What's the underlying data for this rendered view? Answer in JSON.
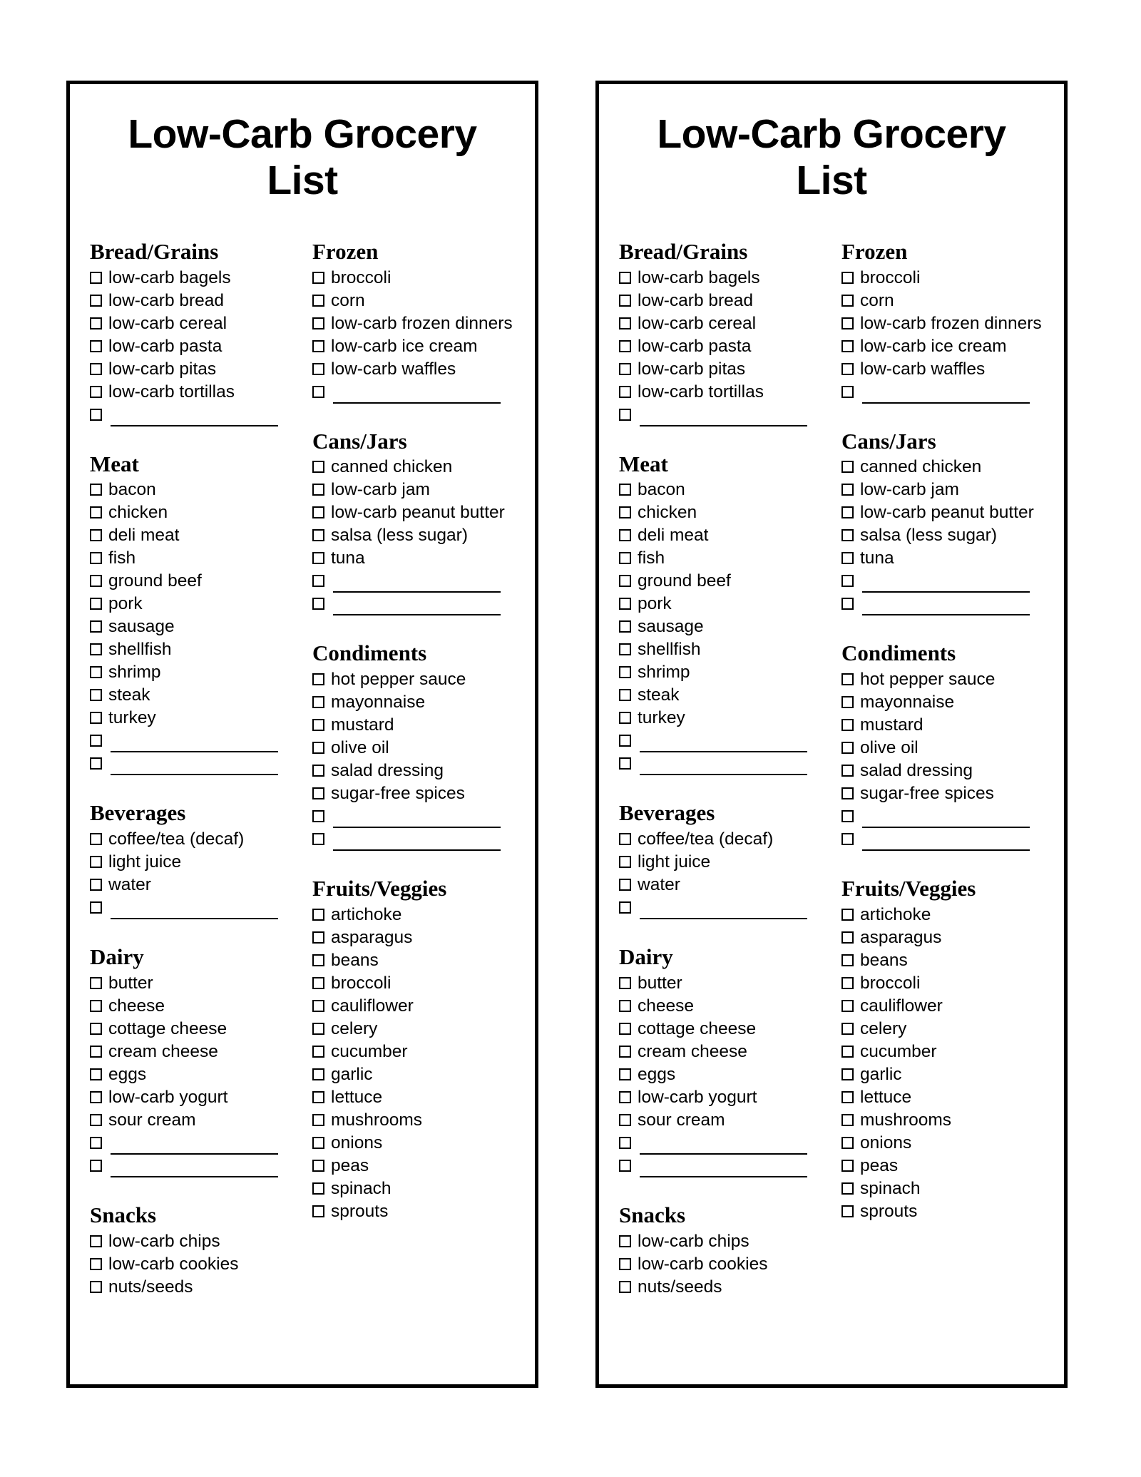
{
  "document": {
    "title": "Low-Carb Grocery List",
    "card_count": 2
  },
  "card": {
    "title": "Low-Carb Grocery List",
    "columns": [
      {
        "name": "left-column",
        "sections": [
          {
            "heading": "Bread/Grains",
            "items": [
              {
                "label": "low-carb bagels",
                "blank": false
              },
              {
                "label": "low-carb bread",
                "blank": false
              },
              {
                "label": "low-carb cereal",
                "blank": false
              },
              {
                "label": "low-carb pasta",
                "blank": false
              },
              {
                "label": "low-carb pitas",
                "blank": false
              },
              {
                "label": "low-carb tortillas",
                "blank": false
              },
              {
                "label": "",
                "blank": true
              }
            ]
          },
          {
            "heading": "Meat",
            "items": [
              {
                "label": "bacon",
                "blank": false
              },
              {
                "label": "chicken",
                "blank": false
              },
              {
                "label": "deli meat",
                "blank": false
              },
              {
                "label": "fish",
                "blank": false
              },
              {
                "label": "ground beef",
                "blank": false
              },
              {
                "label": "pork",
                "blank": false
              },
              {
                "label": "sausage",
                "blank": false
              },
              {
                "label": "shellfish",
                "blank": false
              },
              {
                "label": "shrimp",
                "blank": false
              },
              {
                "label": "steak",
                "blank": false
              },
              {
                "label": "turkey",
                "blank": false
              },
              {
                "label": "",
                "blank": true
              },
              {
                "label": "",
                "blank": true
              }
            ]
          },
          {
            "heading": "Beverages",
            "items": [
              {
                "label": "coffee/tea (decaf)",
                "blank": false
              },
              {
                "label": "light juice",
                "blank": false
              },
              {
                "label": "water",
                "blank": false
              },
              {
                "label": "",
                "blank": true
              }
            ]
          },
          {
            "heading": "Dairy",
            "items": [
              {
                "label": "butter",
                "blank": false
              },
              {
                "label": "cheese",
                "blank": false
              },
              {
                "label": "cottage cheese",
                "blank": false
              },
              {
                "label": "cream cheese",
                "blank": false
              },
              {
                "label": "eggs",
                "blank": false
              },
              {
                "label": "low-carb yogurt",
                "blank": false
              },
              {
                "label": "sour cream",
                "blank": false
              },
              {
                "label": "",
                "blank": true
              },
              {
                "label": "",
                "blank": true
              }
            ]
          },
          {
            "heading": "Snacks",
            "items": [
              {
                "label": "low-carb chips",
                "blank": false
              },
              {
                "label": "low-carb cookies",
                "blank": false
              },
              {
                "label": "nuts/seeds",
                "blank": false
              }
            ]
          }
        ]
      },
      {
        "name": "right-column",
        "sections": [
          {
            "heading": "Frozen",
            "items": [
              {
                "label": "broccoli",
                "blank": false
              },
              {
                "label": "corn",
                "blank": false
              },
              {
                "label": "low-carb frozen dinners",
                "blank": false
              },
              {
                "label": "low-carb ice cream",
                "blank": false
              },
              {
                "label": "low-carb waffles",
                "blank": false
              },
              {
                "label": "",
                "blank": true
              }
            ]
          },
          {
            "heading": "Cans/Jars",
            "items": [
              {
                "label": "canned chicken",
                "blank": false
              },
              {
                "label": "low-carb jam",
                "blank": false
              },
              {
                "label": "low-carb peanut butter",
                "blank": false
              },
              {
                "label": "salsa (less sugar)",
                "blank": false
              },
              {
                "label": "tuna",
                "blank": false
              },
              {
                "label": "",
                "blank": true
              },
              {
                "label": "",
                "blank": true
              }
            ]
          },
          {
            "heading": "Condiments",
            "items": [
              {
                "label": "hot pepper sauce",
                "blank": false
              },
              {
                "label": "mayonnaise",
                "blank": false
              },
              {
                "label": "mustard",
                "blank": false
              },
              {
                "label": "olive oil",
                "blank": false
              },
              {
                "label": "salad dressing",
                "blank": false
              },
              {
                "label": "sugar-free spices",
                "blank": false
              },
              {
                "label": "",
                "blank": true
              },
              {
                "label": "",
                "blank": true
              }
            ]
          },
          {
            "heading": "Fruits/Veggies",
            "items": [
              {
                "label": "artichoke",
                "blank": false
              },
              {
                "label": "asparagus",
                "blank": false
              },
              {
                "label": "beans",
                "blank": false
              },
              {
                "label": "broccoli",
                "blank": false
              },
              {
                "label": "cauliflower",
                "blank": false
              },
              {
                "label": "celery",
                "blank": false
              },
              {
                "label": "cucumber",
                "blank": false
              },
              {
                "label": "garlic",
                "blank": false
              },
              {
                "label": "lettuce",
                "blank": false
              },
              {
                "label": "mushrooms",
                "blank": false
              },
              {
                "label": "onions",
                "blank": false
              },
              {
                "label": "peas",
                "blank": false
              },
              {
                "label": "spinach",
                "blank": false
              },
              {
                "label": "sprouts",
                "blank": false
              }
            ]
          }
        ]
      }
    ]
  },
  "colors": {
    "ink": "#000000",
    "paper": "#ffffff"
  }
}
